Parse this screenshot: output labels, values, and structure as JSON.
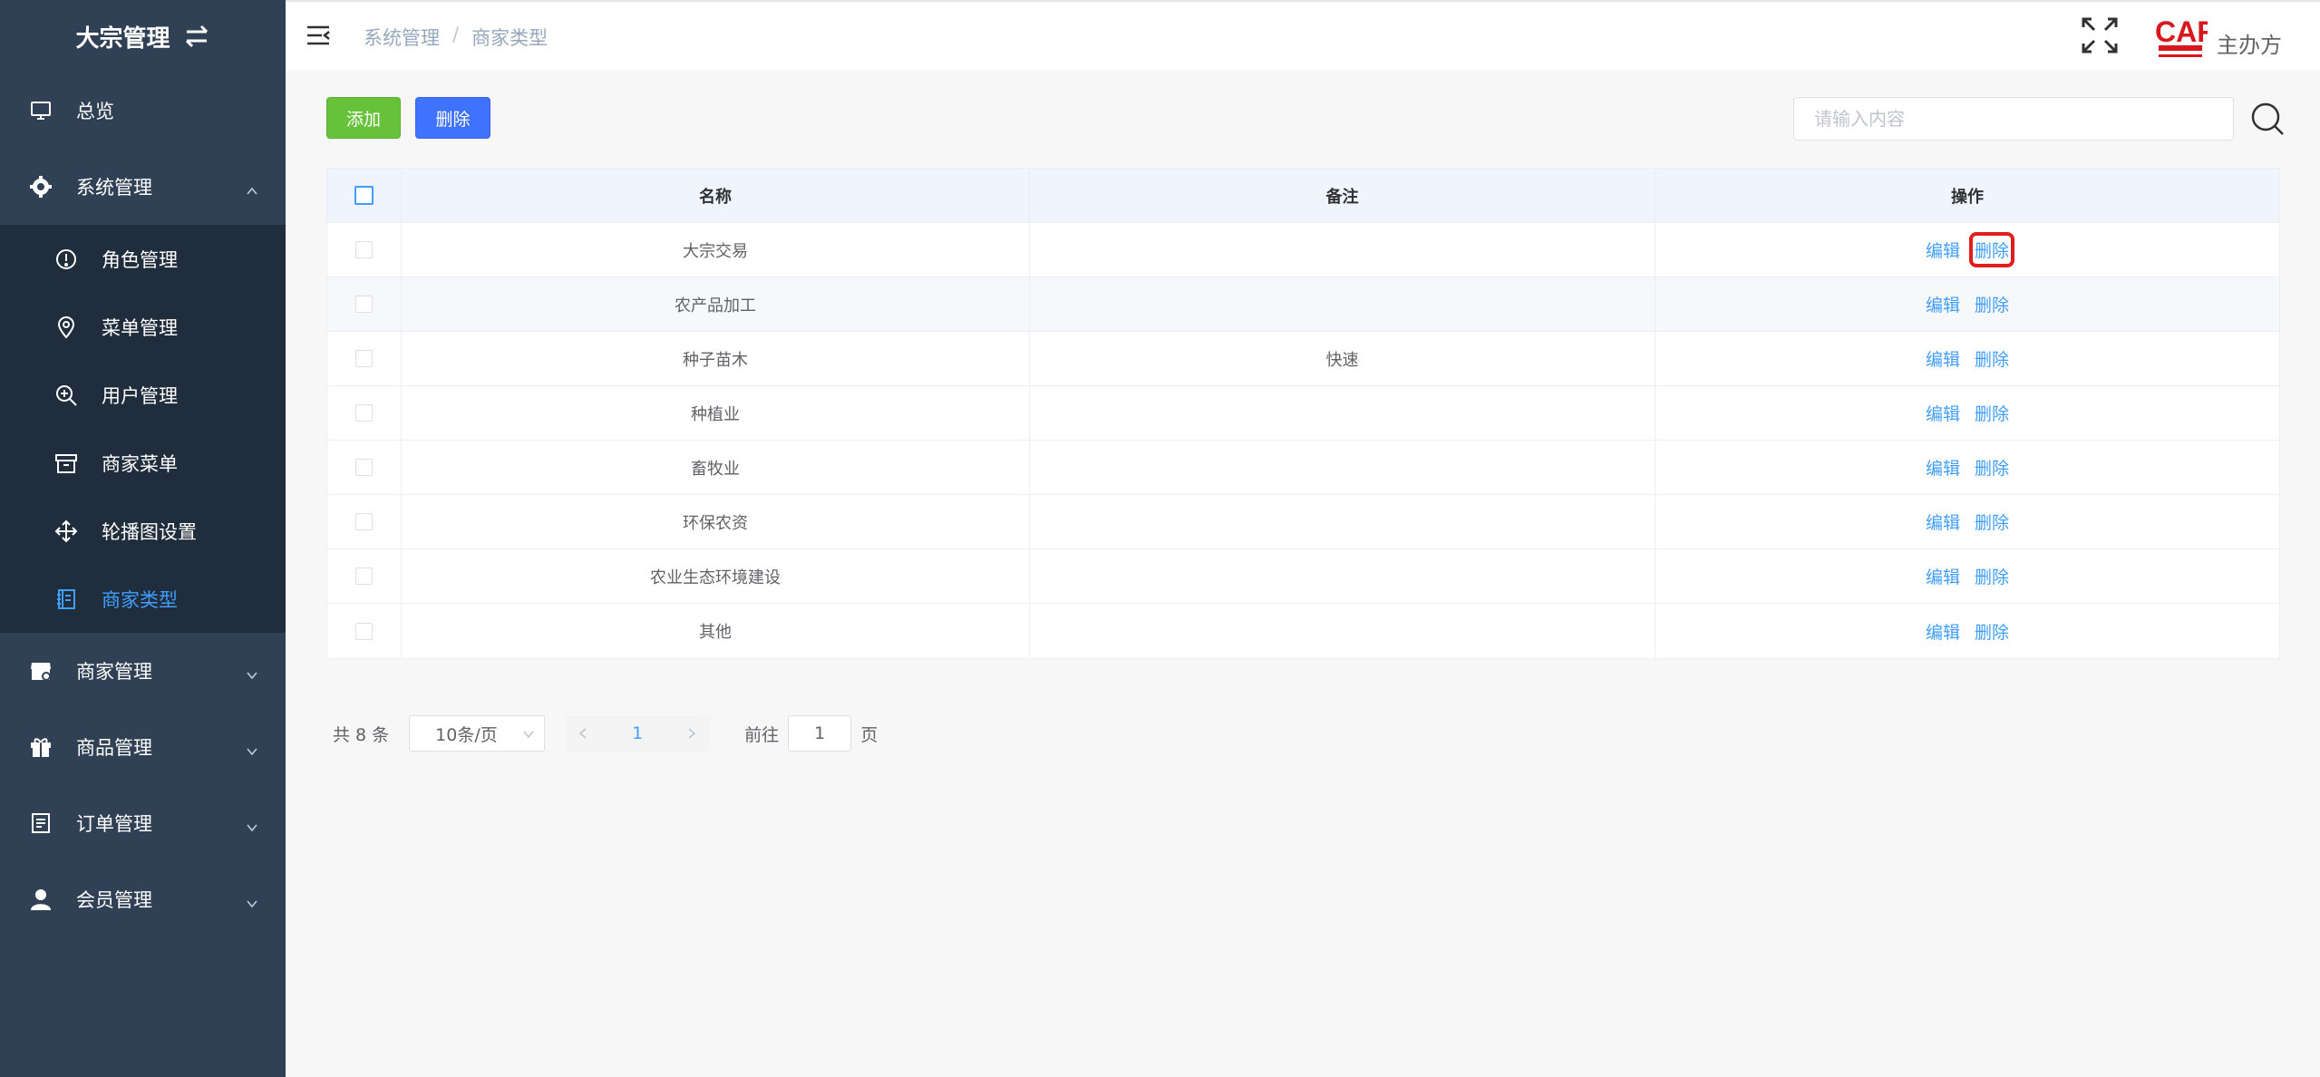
{
  "sidebar": {
    "brand": "大宗管理",
    "items": [
      {
        "label": "总览",
        "icon": "monitor-icon"
      },
      {
        "label": "系统管理",
        "icon": "gear-icon",
        "expanded": true
      },
      {
        "label": "商家管理",
        "icon": "store-icon"
      },
      {
        "label": "商品管理",
        "icon": "gift-icon"
      },
      {
        "label": "订单管理",
        "icon": "document-icon"
      },
      {
        "label": "会员管理",
        "icon": "user-icon"
      }
    ],
    "sub_items": [
      {
        "label": "角色管理",
        "icon": "info-circle-icon"
      },
      {
        "label": "菜单管理",
        "icon": "location-icon"
      },
      {
        "label": "用户管理",
        "icon": "zoom-in-icon"
      },
      {
        "label": "商家菜单",
        "icon": "box-icon"
      },
      {
        "label": "轮播图设置",
        "icon": "rank-icon"
      },
      {
        "label": "商家类型",
        "icon": "notebook-icon",
        "active": true
      }
    ],
    "active_color": "#409eff"
  },
  "header": {
    "breadcrumb": [
      "系统管理",
      "商家类型"
    ],
    "breadcrumb_sep": "/",
    "logo_text": "CAF",
    "host_label": "主办方"
  },
  "toolbar": {
    "add_label": "添加",
    "delete_label": "删除",
    "search_placeholder": "请输入内容"
  },
  "table": {
    "headers": [
      "名称",
      "备注",
      "操作"
    ],
    "rows": [
      {
        "name": "大宗交易",
        "remark": ""
      },
      {
        "name": "农产品加工",
        "remark": ""
      },
      {
        "name": "种子苗木",
        "remark": "快速"
      },
      {
        "name": "种植业",
        "remark": ""
      },
      {
        "name": "畜牧业",
        "remark": ""
      },
      {
        "name": "环保农资",
        "remark": ""
      },
      {
        "name": "农业生态环境建设",
        "remark": ""
      },
      {
        "name": "其他",
        "remark": ""
      }
    ],
    "edit_label": "编辑",
    "delete_label": "删除"
  },
  "pagination": {
    "total": "共 8 条",
    "page_size": "10条/页",
    "current_page": "1",
    "goto_label": "前往",
    "goto_value": "1",
    "page_suffix": "页"
  },
  "colors": {
    "sidebar_bg": "#304156",
    "submenu_bg": "#1f2d3d",
    "add_button": "#67c23a",
    "delete_button": "#3f73ff",
    "link": "#409eff",
    "highlight_box": "#e21d1d"
  }
}
